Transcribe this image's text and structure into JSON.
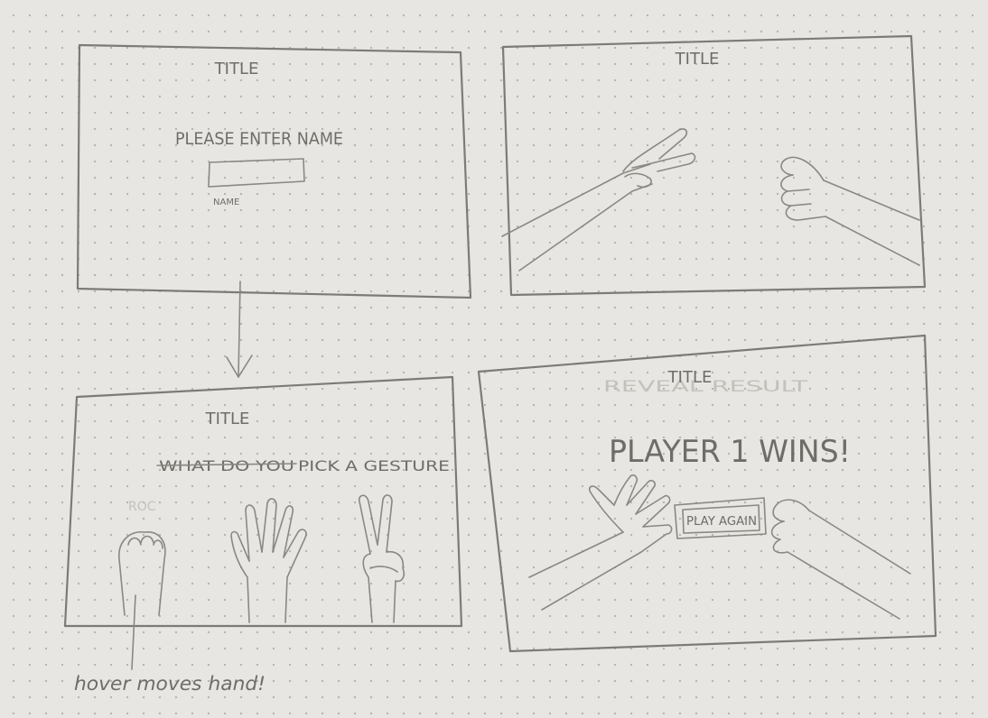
{
  "colors": {
    "paper": "#e7e6e2",
    "pencil": "#7d7b76",
    "faint_pencil": "#bdbbb5"
  },
  "panel1": {
    "title": "TITLE",
    "prompt": "PLEASE ENTER NAME",
    "input_label": "NAME"
  },
  "panel2": {
    "title": "TITLE"
  },
  "panel3": {
    "title": "TITLE",
    "struck_text": "WHAT DO YOU",
    "prompt": "PICK A GESTURE",
    "faint_label": "ROC"
  },
  "panel4": {
    "title": "TITLE",
    "faint_text": "REVEAL RESULT",
    "result": "PLAYER 1 WINS!",
    "play_again": "PLAY AGAIN"
  },
  "note": "hover moves hand!"
}
